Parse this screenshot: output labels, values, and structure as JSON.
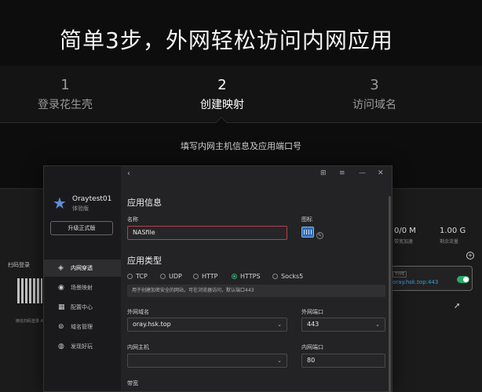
{
  "headline": "简单3步，外网轻松访问内网应用",
  "steps": [
    {
      "num": "1",
      "label": "登录花生壳"
    },
    {
      "num": "2",
      "label": "创建映射"
    },
    {
      "num": "3",
      "label": "访问域名"
    }
  ],
  "subcaption": "填写内网主机信息及应用端口号",
  "left_ghost": {
    "scan_title": "扫码登录",
    "qr_note": "微信扫码登录 APP"
  },
  "right_ghost": {
    "stat1_value": "0/0 M",
    "stat1_label": "带宽加速",
    "stat2_value": "1.00 G",
    "stat2_label": "剩余流量",
    "card_tag": "TYPE",
    "card_url": "oray.hsk.top:443"
  },
  "sidebar": {
    "user_name": "Oraytest01",
    "user_plan": "体验版",
    "upgrade_label": "升级正式版",
    "items": [
      {
        "label": "内网穿透",
        "icon": "cube-icon"
      },
      {
        "label": "场景映射",
        "icon": "scene-icon"
      },
      {
        "label": "配置中心",
        "icon": "config-icon"
      },
      {
        "label": "域名管理",
        "icon": "domain-icon"
      },
      {
        "label": "发现好玩",
        "icon": "discover-icon"
      }
    ]
  },
  "form": {
    "app_info_title": "应用信息",
    "name_label": "名称",
    "name_value": "NASfile",
    "icon_label": "图标",
    "app_type_title": "应用类型",
    "types": [
      "TCP",
      "UDP",
      "HTTP",
      "HTTPS",
      "Socks5"
    ],
    "selected_type": "HTTPS",
    "type_hint": "用于创建加密安全的网站，可在浏览器访问，默认端口443",
    "ext_domain_label": "外网域名",
    "ext_domain_value": "oray.hsk.top",
    "ext_port_label": "外网端口",
    "ext_port_value": "443",
    "int_host_label": "内网主机",
    "int_host_value": "",
    "int_port_label": "内网端口",
    "int_port_value": "80",
    "bandwidth_label": "带宽"
  },
  "colors": {
    "accent_green": "#2da86b",
    "focus_red": "#b3424a",
    "link_blue": "#3a9bdc"
  }
}
